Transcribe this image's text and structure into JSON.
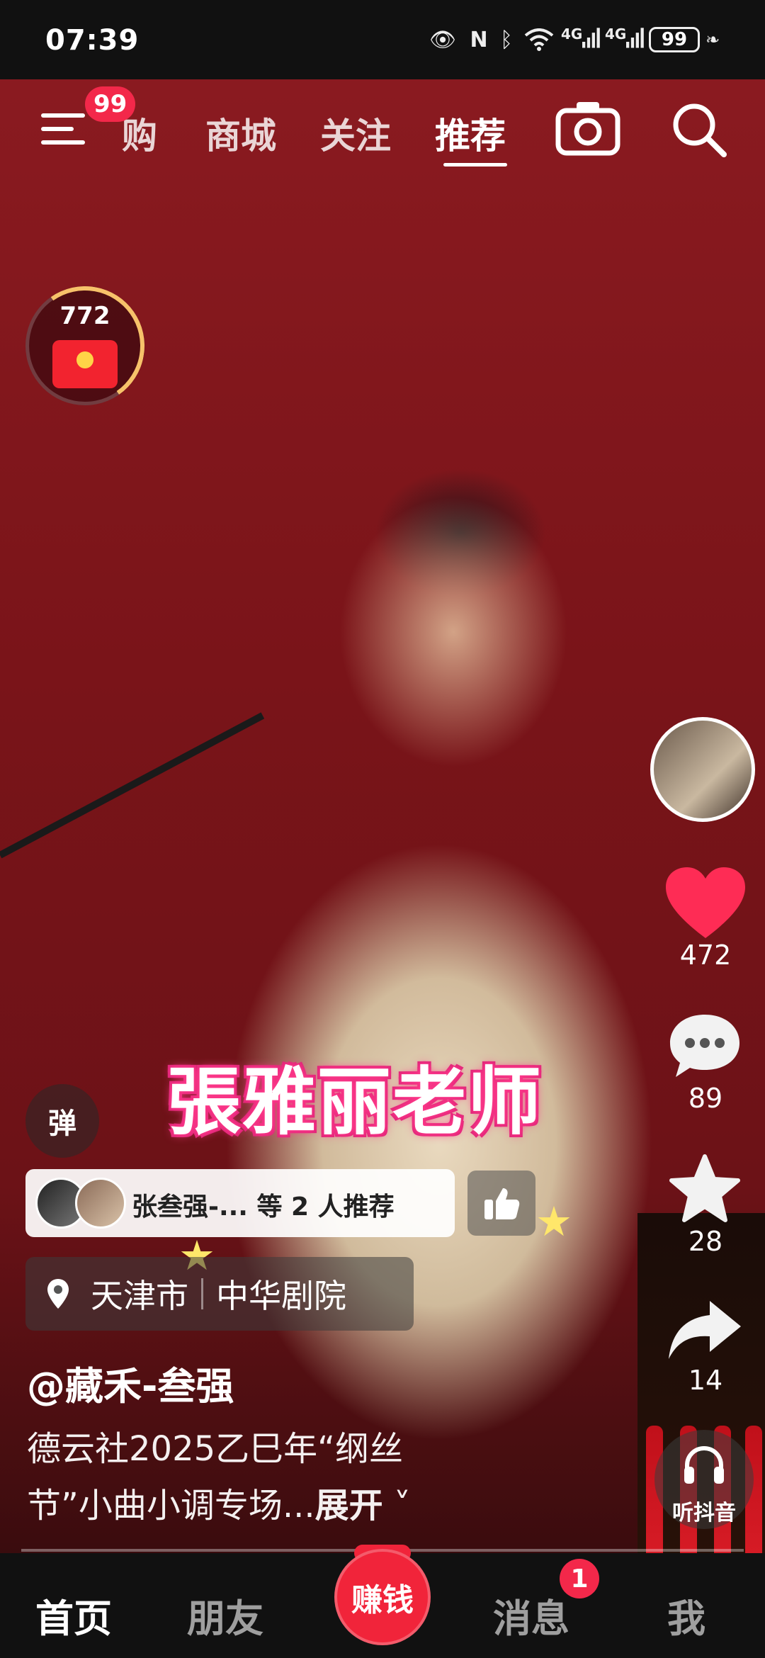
{
  "status_bar": {
    "time": "07:39",
    "network_1": "4G",
    "network_2": "4G",
    "battery": "99"
  },
  "menu": {
    "badge": "99"
  },
  "top_tabs": [
    {
      "label": "购"
    },
    {
      "label": "商城"
    },
    {
      "label": "关注"
    },
    {
      "label": "推荐",
      "active": true
    }
  ],
  "red_packet": {
    "count": "772"
  },
  "video": {
    "subtitle": "張雅丽老师"
  },
  "right_rail": {
    "likes": "472",
    "comments": "89",
    "favorites": "28",
    "shares": "14",
    "listen_label": "听抖音"
  },
  "danmaku": {
    "label": "弹"
  },
  "recommend": {
    "text": "张叁强-... 等 2 人推荐"
  },
  "location": {
    "city": "天津市",
    "venue": "中华剧院"
  },
  "post": {
    "author": "@藏禾-叁强",
    "description_line1": "德云社2025乙巳年“纲丝",
    "description_line2": "节”小曲小调专场...",
    "expand_label": "展开"
  },
  "bottom_tabs": [
    {
      "label": "首页",
      "active": true
    },
    {
      "label": "朋友"
    },
    {
      "label": "赚钱"
    },
    {
      "label": "消息",
      "badge": "1"
    },
    {
      "label": "我"
    }
  ],
  "colors": {
    "accent": "#f3284a",
    "like": "#fe2c55",
    "background": "#7a1419"
  },
  "icons": [
    "menu-icon",
    "camera-icon",
    "search-icon",
    "heart-icon",
    "comment-icon",
    "star-icon",
    "share-icon",
    "headphones-icon",
    "location-pin-icon",
    "thumbs-up-icon"
  ]
}
